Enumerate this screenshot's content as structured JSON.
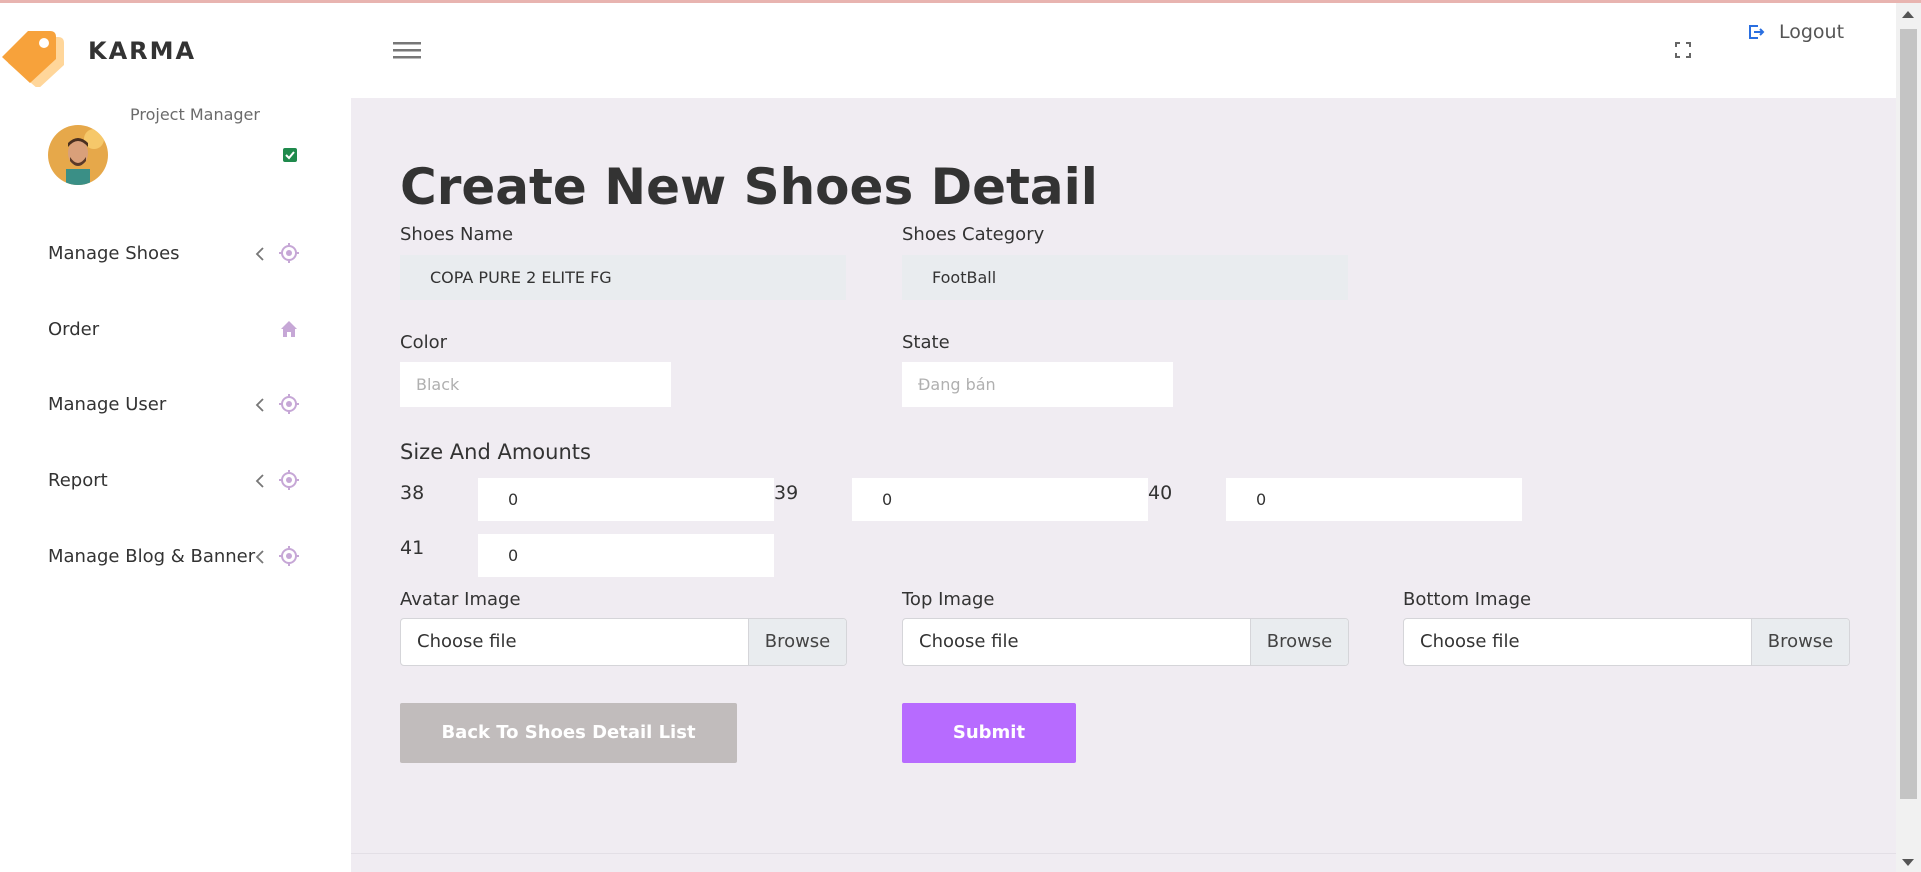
{
  "brand": {
    "name": "KARMA"
  },
  "user": {
    "role": "Project Manager"
  },
  "sidebar": {
    "items": [
      {
        "label": "Manage Shoes",
        "icon": "crosshair-icon",
        "has_chevron": true
      },
      {
        "label": "Order",
        "icon": "home-icon",
        "has_chevron": false
      },
      {
        "label": "Manage User",
        "icon": "crosshair-icon",
        "has_chevron": true
      },
      {
        "label": "Report",
        "icon": "crosshair-icon",
        "has_chevron": true
      },
      {
        "label": "Manage Blog & Banner",
        "icon": "crosshair-icon",
        "has_chevron": true
      }
    ]
  },
  "header": {
    "logout_label": "Logout"
  },
  "form": {
    "title": "Create New Shoes Detail",
    "shoes_name_label": "Shoes Name",
    "shoes_name_value": "COPA PURE 2 ELITE FG",
    "shoes_category_label": "Shoes Category",
    "shoes_category_value": "FootBall",
    "color_label": "Color",
    "color_placeholder": "Black",
    "state_label": "State",
    "state_placeholder": "Đang bán",
    "sizes_label": "Size And Amounts",
    "sizes": [
      {
        "size": "38",
        "amount": "0"
      },
      {
        "size": "39",
        "amount": "0"
      },
      {
        "size": "40",
        "amount": "0"
      },
      {
        "size": "41",
        "amount": "0"
      }
    ],
    "avatar_image_label": "Avatar Image",
    "top_image_label": "Top Image",
    "bottom_image_label": "Bottom Image",
    "file_placeholder": "Choose file",
    "browse_label": "Browse",
    "back_button": "Back To Shoes Detail List",
    "submit_button": "Submit"
  },
  "colors": {
    "accent": "#b76bff",
    "back_button": "#c1bcbc",
    "main_background": "#f0ecf2",
    "nav_icon": "#c6a7d6",
    "logo": "#f7a23b"
  }
}
